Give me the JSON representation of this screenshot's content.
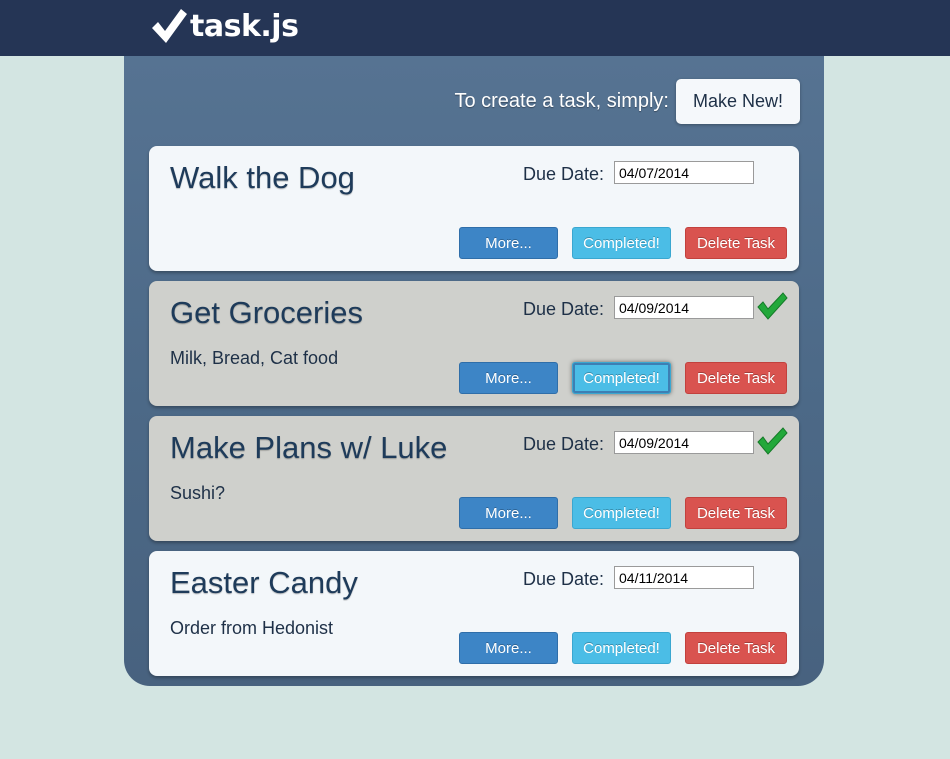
{
  "app": {
    "logo_text": "task.js"
  },
  "header": {
    "create_label": "To create a task, simply:",
    "make_new_label": "Make New!"
  },
  "task_labels": {
    "due_date": "Due Date:",
    "more": "More...",
    "completed": "Completed!",
    "delete": "Delete Task"
  },
  "tasks": [
    {
      "title": "Walk the Dog",
      "description": "",
      "due_date": "04/07/2014",
      "completed": false
    },
    {
      "title": "Get Groceries",
      "description": "Milk, Bread, Cat food",
      "due_date": "04/09/2014",
      "completed": true
    },
    {
      "title": "Make Plans w/ Luke",
      "description": "Sushi?",
      "due_date": "04/09/2014",
      "completed": true
    },
    {
      "title": "Easter Candy",
      "description": "Order from Hedonist",
      "due_date": "04/11/2014",
      "completed": false
    }
  ],
  "colors": {
    "topbar": "#253555",
    "panel": "#4c6987",
    "background": "#d3e5e2",
    "more_button": "#3d85c6",
    "completed_button": "#4bbde6",
    "delete_button": "#d9534f",
    "check": "#22a83a"
  }
}
